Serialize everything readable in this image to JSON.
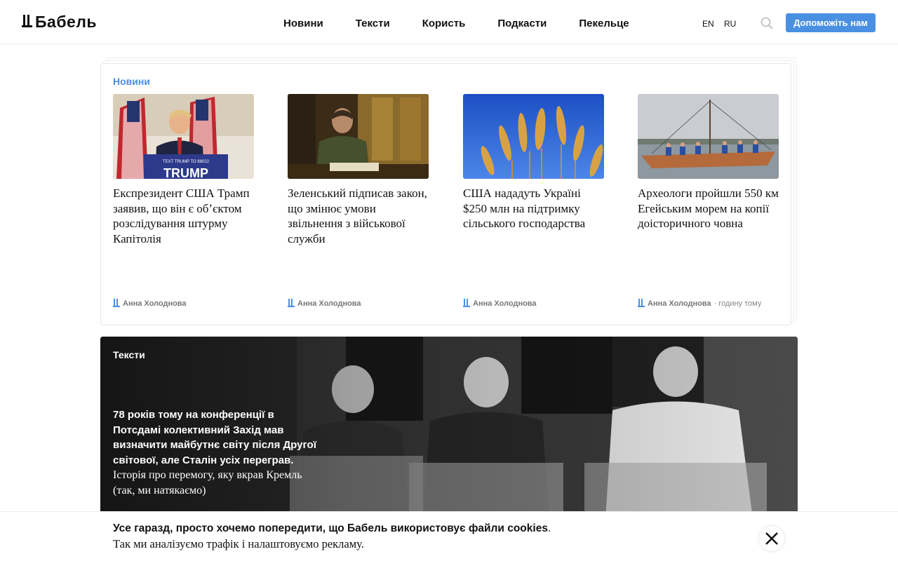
{
  "header": {
    "logo_text": "Бабель",
    "nav": [
      "Новини",
      "Тексти",
      "Користь",
      "Подкасти",
      "Пекельце"
    ],
    "langs": [
      "EN",
      "RU"
    ],
    "donate_label": "Допоможіть нам"
  },
  "news": {
    "section_title": "Новини",
    "items": [
      {
        "title": "Експрезидент США Трамп заявив, що він є обʼєктом розслідування штурму Капітолія",
        "author": "Анна Холоднова",
        "time": "",
        "image": "trump-podium-photo"
      },
      {
        "title": "Зеленський підписав закон, що змінює умови звільнення з військової служби",
        "author": "Анна Холоднова",
        "time": "",
        "image": "zelensky-signing-photo"
      },
      {
        "title": "США нададуть Україні $250 млн на підтримку сільського господарства",
        "author": "Анна Холоднова",
        "time": "",
        "image": "wheat-sky-photo"
      },
      {
        "title": "Археологи пройшли 550 км Егейським морем на копії доісторичного човна",
        "author": "Анна Холоднова",
        "time": "· годину тому",
        "image": "rowing-boat-photo"
      }
    ],
    "podium_sign": "TRUMP",
    "podium_small": "TEXT TRUMP TO 88022"
  },
  "feature": {
    "label": "Тексти",
    "headline_bold": "78 років тому на конференції в Потсдамі колективний Захід мав визначити майбутнє світу після Другої світової, але Сталін усіх переграв.",
    "headline_lead": "Історія про перемогу, яку вкрав Кремль (так, ми натякаємо)",
    "image": "potsdam-conference-photo"
  },
  "cookie": {
    "line1": "Усе гаразд, просто хочемо попередити, що Бабель використовує файли cookies",
    "line1_end": ".",
    "line2": "Так ми аналізуємо трафік і налаштовуємо рекламу."
  },
  "colors": {
    "accent": "#4a90e2",
    "text": "#111111",
    "muted": "#777777"
  },
  "icons": [
    "babel-logo-icon",
    "search-icon",
    "close-icon",
    "author-mark-icon"
  ]
}
